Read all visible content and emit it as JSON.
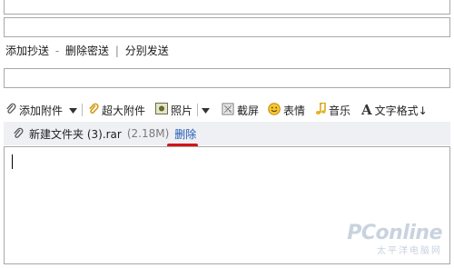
{
  "recipients": {
    "add_cc": "添加抄送",
    "remove_bcc": "删除密送",
    "separate_send": "分别发送",
    "dash": "-",
    "bar": "|"
  },
  "toolbar": {
    "add_attachment": "添加附件",
    "large_attachment": "超大附件",
    "photo": "照片",
    "screenshot": "截屏",
    "emoji": "表情",
    "music": "音乐",
    "text_format": "文字格式↓"
  },
  "attachment": {
    "file_name": "新建文件夹 (3).rar",
    "file_size": "(2.18M)",
    "delete_label": "删除"
  },
  "watermark": {
    "logo": "PConline",
    "sub": "太平洋电脑网"
  },
  "colors": {
    "delete_underline": "#d0171b",
    "watermark": "#c9d3df"
  }
}
